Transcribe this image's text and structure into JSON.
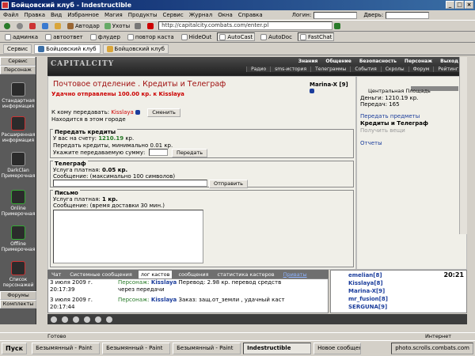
{
  "window": {
    "title": "Бойцовский клуб - Indestructible"
  },
  "menu": [
    "Файл",
    "Правка",
    "Вид",
    "Избранное",
    "Магия",
    "Продукты",
    "Сервис",
    "Журнал",
    "Окна",
    "Справка"
  ],
  "login": {
    "label": "Логин:",
    "door_label": "Дверь:"
  },
  "toolbar": {
    "autodar": "Автодар",
    "uhoty": "Ухоты",
    "address": "http://capitalcity.combats.com/enter.pl"
  },
  "links": [
    "админка",
    "автоответ",
    "флудер",
    "повтор каста",
    "HideOut",
    "AutoCast",
    "AutoDoc",
    "FastChat"
  ],
  "tabs": [
    "Сервис",
    "Бойцовский клуб",
    "Бойцовский клуб"
  ],
  "sidebar": {
    "head1": "Сервис",
    "head2": "Персонаж",
    "items": [
      "Стандартная информация",
      "Расширенная информация",
      "DarkClan Примерочная",
      "Online Примерочная",
      "Offline Примерочная",
      "Список персонажей"
    ],
    "foot1": "Форумы",
    "foot2": "Комплекты"
  },
  "game": {
    "logo": "CAPITALCITY",
    "nav_top": [
      "Знания",
      "Общение",
      "Безопасность",
      "Персонаж",
      "Выход"
    ],
    "nav_bottom": [
      "Радио",
      "sms-история",
      "Телеграммы",
      "События",
      "Скролы",
      "Форум",
      "Рейтинг"
    ],
    "page_title": "Почтовое отделение .  Кредиты и Телеграф",
    "user": "Marina-X [9]",
    "success": "Удачно отправлены 100.00 кр. к Kisslaya",
    "recipient_label": "К кому передавать:",
    "recipient": "Kisslaya",
    "change_btn": "Сменить",
    "same_city": "Находится в этом городе",
    "credits": {
      "title": "Передать кредиты",
      "balance_label": "У вас на счету:",
      "balance": "1210.19",
      "currency": "кр.",
      "min": "Передать кредиты, минимально 0.01 кр.",
      "sum_label": "Укажите передаваемую сумму:",
      "btn": "Передать"
    },
    "telegraph": {
      "title": "Телеграф",
      "service": "Услуга платная:",
      "price": "0.05 кр.",
      "msg": "Сообщение: (максимально 100 символов)",
      "btn": "Отправить"
    },
    "letter": {
      "title": "Письмо",
      "service": "Услуга платная:",
      "price": "1 кр.",
      "msg": "Сообщение: (время доставки 30 мин.)"
    },
    "right": {
      "place": "Центральная Площадь",
      "money": "Деньги: 1210.19 кр.",
      "transfers": "Передач: 165",
      "link1": "Передать предметы",
      "link2": "Кредиты и Телеграф",
      "link3": "Получить вещи",
      "link4": "Отчеты"
    }
  },
  "chat": {
    "tabs": [
      "Чат",
      "Системные сообщения",
      "лог кастов",
      "сообщения",
      "статистика кастеров",
      "Приваты"
    ],
    "lines": [
      {
        "date": "3 июля 2009 г.",
        "time": "20:17:39",
        "who": "Персонаж:",
        "nick": "Kisslaya",
        "text": "Перевод: 2.98 кр. перевод средств",
        "text2": "через передачи"
      },
      {
        "date": "3 июля 2009 г.",
        "time": "20:17:44",
        "who": "Персонаж:",
        "nick": "Kisslaya",
        "text": "Заказ: защ.от_земли , удачный каст",
        "text2": ""
      }
    ]
  },
  "users": {
    "time": "20:21",
    "list": [
      "emelian[8]",
      "Kisslaya[8]",
      "Marina-X[9]",
      "mr_fusion[8]",
      "SERGUNA[9]"
    ]
  },
  "statusbar": {
    "left": "Готово",
    "right": "Интернет"
  },
  "taskbar": {
    "start": "Пуск",
    "tasks": [
      "Безымянный - Paint",
      "Безымянный - Paint",
      "Безымянный - Paint",
      "Indestructible",
      "Новое сообщение"
    ],
    "watermark": "photo.scrolls.combats.com"
  }
}
